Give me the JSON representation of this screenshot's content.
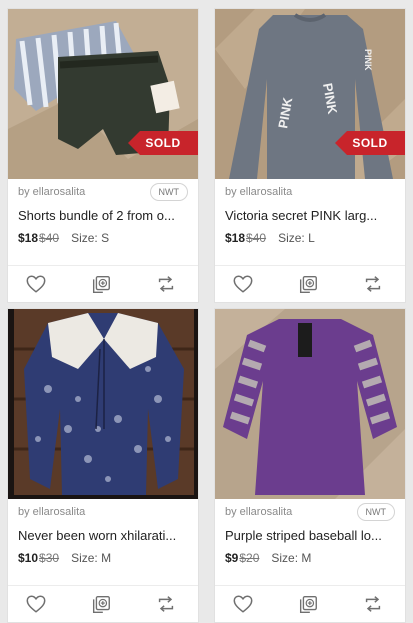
{
  "listings": [
    {
      "seller": "by ellarosalita",
      "condition_badge": "NWT",
      "title": "Shorts bundle of 2 from o...",
      "price": "$18",
      "original_price": "$40",
      "size": "Size: S",
      "sold_label": "SOLD",
      "icons": [
        "heart-icon",
        "add-to-bundle-icon",
        "share-icon"
      ]
    },
    {
      "seller": "by ellarosalita",
      "title": "Victoria secret PINK larg...",
      "price": "$18",
      "original_price": "$40",
      "size": "Size: L",
      "sold_label": "SOLD",
      "image_text": [
        "PINK",
        "PINK",
        "PINK"
      ],
      "icons": [
        "heart-icon",
        "add-to-bundle-icon",
        "share-icon"
      ]
    },
    {
      "seller": "by ellarosalita",
      "title": "Never been worn xhilarati...",
      "price": "$10",
      "original_price": "$30",
      "size": "Size: M",
      "icons": [
        "heart-icon",
        "add-to-bundle-icon",
        "share-icon"
      ]
    },
    {
      "seller": "by ellarosalita",
      "condition_badge": "NWT",
      "title": "Purple striped baseball lo...",
      "price": "$9",
      "original_price": "$20",
      "size": "Size: M",
      "icons": [
        "heart-icon",
        "add-to-bundle-icon",
        "share-icon"
      ]
    }
  ],
  "colors": {
    "sold_badge": "#c8242b",
    "page_background": "#e9e9e9",
    "icon": "#6f6f6f"
  }
}
